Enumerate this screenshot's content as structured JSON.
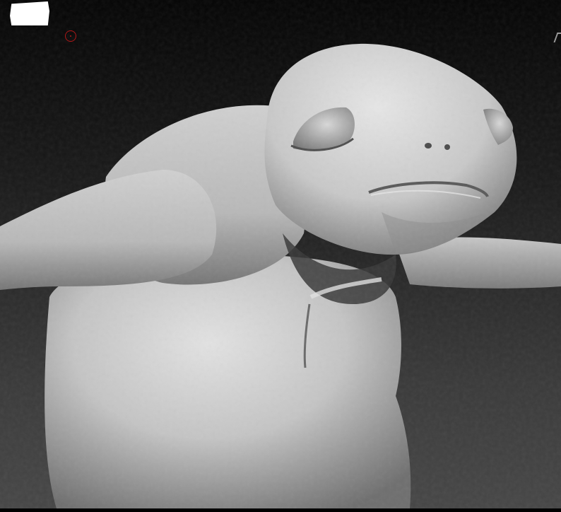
{
  "viewport": {
    "background_top": "#050505",
    "background_bottom": "#474747",
    "model": "clay-sculpt-creature",
    "model_color": "#bdbdbd"
  },
  "overlay": {
    "thumbnail_color": "#ffffff",
    "brush_cursor_color": "#b01818"
  }
}
